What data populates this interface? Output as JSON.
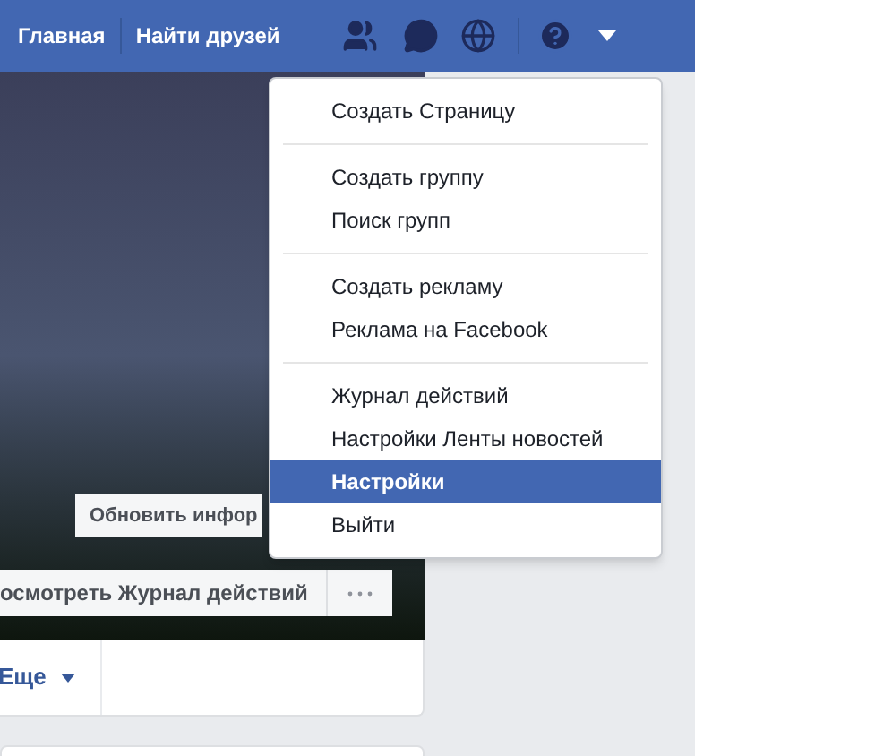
{
  "top_bar": {
    "links": [
      {
        "label": "Главная"
      },
      {
        "label": "Найти друзей"
      }
    ]
  },
  "cover": {
    "update_button": "Обновить инфор",
    "activity_button": "осмотреть Журнал действий"
  },
  "profile_tabs": {
    "more": "Еще"
  },
  "menu": {
    "sections": [
      {
        "items": [
          {
            "label": "Создать Страницу",
            "selected": false
          }
        ]
      },
      {
        "items": [
          {
            "label": "Создать группу",
            "selected": false
          },
          {
            "label": "Поиск групп",
            "selected": false
          }
        ]
      },
      {
        "items": [
          {
            "label": "Создать рекламу",
            "selected": false
          },
          {
            "label": "Реклама на Facebook",
            "selected": false
          }
        ]
      },
      {
        "items": [
          {
            "label": "Журнал действий",
            "selected": false
          },
          {
            "label": "Настройки Ленты новостей",
            "selected": false
          },
          {
            "label": "Настройки",
            "selected": true
          },
          {
            "label": "Выйти",
            "selected": false
          }
        ]
      }
    ]
  }
}
